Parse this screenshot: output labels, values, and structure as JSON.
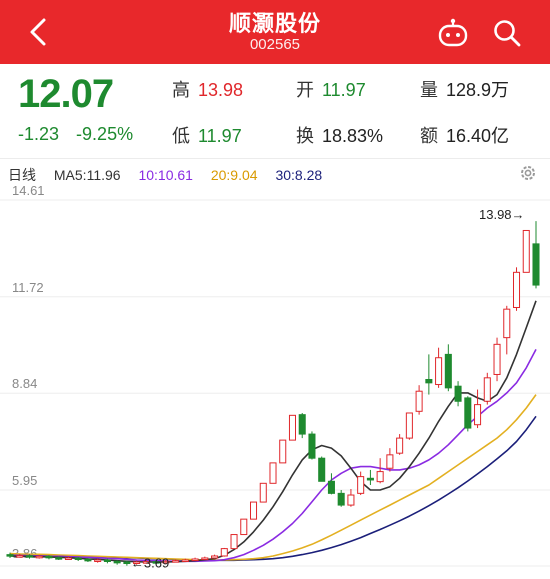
{
  "header": {
    "title": "顺灏股份",
    "code": "002565",
    "colors": {
      "bar": "#e8282b"
    },
    "icons": {
      "back": "chevron-left-icon",
      "robot": "robot-icon",
      "search": "search-icon"
    }
  },
  "quote": {
    "price": "12.07",
    "change": "-1.23",
    "change_pct": "-9.25%",
    "high_label": "高",
    "high": "13.98",
    "low_label": "低",
    "low": "11.97",
    "open_label": "开",
    "open": "11.97",
    "turnover_label": "换",
    "turnover": "18.83%",
    "volume_label": "量",
    "volume": "128.9万",
    "amount_label": "额",
    "amount": "16.40亿"
  },
  "chart_header": {
    "period": "日线",
    "ma5": "MA5:11.96",
    "ma10": "10:10.61",
    "ma20": "20:9.04",
    "ma30": "30:8.28",
    "icon": "gear-icon"
  },
  "chart_data": {
    "type": "candlestick",
    "y_ticks": [
      "14.61",
      "11.72",
      "8.84",
      "5.95",
      "3.86"
    ],
    "ylim": [
      3.86,
      14.61
    ],
    "max_marker": "13.98→",
    "min_marker": "←3.69",
    "colors": {
      "up": "#e0272b",
      "down": "#1e8a2f",
      "ma5": "#333333",
      "ma10": "#8a2be2",
      "ma20": "#e3b021",
      "ma30": "#1b1f7a"
    },
    "candles": [
      {
        "o": 4.02,
        "c": 3.98,
        "h": 4.08,
        "l": 3.92
      },
      {
        "o": 3.98,
        "c": 3.99,
        "h": 4.04,
        "l": 3.93
      },
      {
        "o": 3.99,
        "c": 3.95,
        "h": 4.03,
        "l": 3.9
      },
      {
        "o": 3.95,
        "c": 3.97,
        "h": 4.01,
        "l": 3.9
      },
      {
        "o": 3.97,
        "c": 3.93,
        "h": 4.0,
        "l": 3.88
      },
      {
        "o": 3.93,
        "c": 3.91,
        "h": 3.97,
        "l": 3.86
      },
      {
        "o": 3.91,
        "c": 3.92,
        "h": 3.96,
        "l": 3.86
      },
      {
        "o": 3.92,
        "c": 3.88,
        "h": 3.95,
        "l": 3.83
      },
      {
        "o": 3.88,
        "c": 3.85,
        "h": 3.92,
        "l": 3.8
      },
      {
        "o": 3.85,
        "c": 3.86,
        "h": 3.9,
        "l": 3.78
      },
      {
        "o": 3.86,
        "c": 3.82,
        "h": 3.9,
        "l": 3.76
      },
      {
        "o": 3.82,
        "c": 3.8,
        "h": 3.85,
        "l": 3.72
      },
      {
        "o": 3.8,
        "c": 3.78,
        "h": 3.83,
        "l": 3.69
      },
      {
        "o": 3.78,
        "c": 3.8,
        "h": 3.84,
        "l": 3.72
      },
      {
        "o": 3.8,
        "c": 3.81,
        "h": 3.85,
        "l": 3.75
      },
      {
        "o": 3.81,
        "c": 3.79,
        "h": 3.86,
        "l": 3.75
      },
      {
        "o": 3.79,
        "c": 3.82,
        "h": 3.86,
        "l": 3.76
      },
      {
        "o": 3.82,
        "c": 3.84,
        "h": 3.88,
        "l": 3.8
      },
      {
        "o": 3.84,
        "c": 3.86,
        "h": 3.9,
        "l": 3.81
      },
      {
        "o": 3.86,
        "c": 3.89,
        "h": 3.93,
        "l": 3.83
      },
      {
        "o": 3.89,
        "c": 3.92,
        "h": 3.96,
        "l": 3.86
      },
      {
        "o": 3.92,
        "c": 3.98,
        "h": 4.02,
        "l": 3.9
      },
      {
        "o": 3.98,
        "c": 4.2,
        "h": 4.22,
        "l": 3.96
      },
      {
        "o": 4.2,
        "c": 4.62,
        "h": 4.62,
        "l": 4.2
      },
      {
        "o": 4.62,
        "c": 5.08,
        "h": 5.08,
        "l": 4.62
      },
      {
        "o": 5.08,
        "c": 5.59,
        "h": 5.59,
        "l": 5.08
      },
      {
        "o": 5.59,
        "c": 6.15,
        "h": 6.15,
        "l": 5.59
      },
      {
        "o": 6.15,
        "c": 6.76,
        "h": 6.76,
        "l": 6.15
      },
      {
        "o": 6.76,
        "c": 7.44,
        "h": 7.44,
        "l": 6.76
      },
      {
        "o": 7.44,
        "c": 8.18,
        "h": 8.18,
        "l": 7.44
      },
      {
        "o": 8.2,
        "c": 7.62,
        "h": 8.25,
        "l": 7.5
      },
      {
        "o": 7.62,
        "c": 6.9,
        "h": 7.7,
        "l": 6.86
      },
      {
        "o": 6.9,
        "c": 6.21,
        "h": 6.95,
        "l": 6.21
      },
      {
        "o": 6.21,
        "c": 5.85,
        "h": 6.45,
        "l": 5.82
      },
      {
        "o": 5.85,
        "c": 5.5,
        "h": 5.95,
        "l": 5.45
      },
      {
        "o": 5.5,
        "c": 5.8,
        "h": 5.98,
        "l": 5.45
      },
      {
        "o": 5.85,
        "c": 6.35,
        "h": 6.5,
        "l": 5.8
      },
      {
        "o": 6.3,
        "c": 6.25,
        "h": 6.55,
        "l": 6.1
      },
      {
        "o": 6.2,
        "c": 6.5,
        "h": 6.9,
        "l": 6.15
      },
      {
        "o": 6.6,
        "c": 7.0,
        "h": 7.2,
        "l": 6.5
      },
      {
        "o": 7.05,
        "c": 7.5,
        "h": 7.62,
        "l": 7.0
      },
      {
        "o": 7.5,
        "c": 8.25,
        "h": 8.25,
        "l": 7.45
      },
      {
        "o": 8.3,
        "c": 8.9,
        "h": 9.08,
        "l": 8.2
      },
      {
        "o": 9.25,
        "c": 9.15,
        "h": 10.0,
        "l": 8.8
      },
      {
        "o": 9.1,
        "c": 9.9,
        "h": 10.2,
        "l": 9.0
      },
      {
        "o": 10.0,
        "c": 9.0,
        "h": 10.3,
        "l": 8.9
      },
      {
        "o": 9.05,
        "c": 8.6,
        "h": 9.2,
        "l": 8.45
      },
      {
        "o": 8.7,
        "c": 7.8,
        "h": 8.75,
        "l": 7.7
      },
      {
        "o": 7.9,
        "c": 8.5,
        "h": 8.95,
        "l": 7.8
      },
      {
        "o": 8.6,
        "c": 9.3,
        "h": 9.45,
        "l": 8.5
      },
      {
        "o": 9.4,
        "c": 10.3,
        "h": 10.5,
        "l": 9.2
      },
      {
        "o": 10.5,
        "c": 11.35,
        "h": 11.45,
        "l": 10.0
      },
      {
        "o": 11.4,
        "c": 12.45,
        "h": 12.6,
        "l": 11.3
      },
      {
        "o": 12.45,
        "c": 13.7,
        "h": 13.7,
        "l": 12.45
      },
      {
        "o": 13.3,
        "c": 12.07,
        "h": 13.98,
        "l": 11.97
      }
    ],
    "ma5": [
      3.98,
      3.97,
      3.97,
      3.96,
      3.95,
      3.94,
      3.93,
      3.91,
      3.89,
      3.88,
      3.86,
      3.84,
      3.82,
      3.81,
      3.8,
      3.8,
      3.8,
      3.81,
      3.82,
      3.84,
      3.87,
      3.9,
      4.0,
      4.17,
      4.4,
      4.7,
      5.05,
      5.45,
      5.9,
      6.4,
      6.85,
      7.15,
      7.28,
      7.2,
      6.97,
      6.6,
      6.2,
      5.95,
      5.95,
      6.05,
      6.3,
      6.65,
      7.05,
      7.5,
      8.0,
      8.45,
      8.85,
      8.85,
      8.7,
      8.6,
      8.8,
      9.3,
      10.0,
      10.8,
      11.6
    ],
    "ma10": [
      4.0,
      3.99,
      3.99,
      3.98,
      3.97,
      3.97,
      3.96,
      3.95,
      3.94,
      3.93,
      3.91,
      3.9,
      3.88,
      3.86,
      3.85,
      3.84,
      3.83,
      3.82,
      3.82,
      3.82,
      3.83,
      3.84,
      3.87,
      3.93,
      4.02,
      4.15,
      4.3,
      4.48,
      4.7,
      4.95,
      5.25,
      5.6,
      5.95,
      6.25,
      6.45,
      6.6,
      6.65,
      6.65,
      6.6,
      6.55,
      6.55,
      6.6,
      6.7,
      6.85,
      7.05,
      7.3,
      7.6,
      7.9,
      8.15,
      8.4,
      8.6,
      8.85,
      9.15,
      9.6,
      10.15
    ],
    "ma20": [
      4.05,
      4.04,
      4.03,
      4.03,
      4.02,
      4.01,
      4.0,
      3.99,
      3.98,
      3.97,
      3.96,
      3.95,
      3.94,
      3.93,
      3.92,
      3.91,
      3.9,
      3.89,
      3.88,
      3.87,
      3.86,
      3.86,
      3.86,
      3.87,
      3.88,
      3.9,
      3.93,
      3.98,
      4.05,
      4.13,
      4.22,
      4.33,
      4.46,
      4.6,
      4.75,
      4.9,
      5.05,
      5.2,
      5.35,
      5.5,
      5.65,
      5.8,
      5.95,
      6.1,
      6.3,
      6.5,
      6.7,
      6.9,
      7.1,
      7.3,
      7.5,
      7.75,
      8.05,
      8.4,
      8.8
    ],
    "ma30": [
      4.03,
      4.02,
      4.01,
      4.01,
      4.0,
      3.99,
      3.98,
      3.97,
      3.97,
      3.96,
      3.95,
      3.94,
      3.93,
      3.92,
      3.91,
      3.9,
      3.89,
      3.88,
      3.87,
      3.86,
      3.85,
      3.85,
      3.85,
      3.85,
      3.86,
      3.87,
      3.88,
      3.9,
      3.93,
      3.97,
      4.02,
      4.08,
      4.15,
      4.23,
      4.32,
      4.42,
      4.53,
      4.65,
      4.77,
      4.9,
      5.03,
      5.17,
      5.32,
      5.48,
      5.65,
      5.83,
      6.02,
      6.22,
      6.43,
      6.65,
      6.88,
      7.12,
      7.4,
      7.75,
      8.15
    ]
  }
}
